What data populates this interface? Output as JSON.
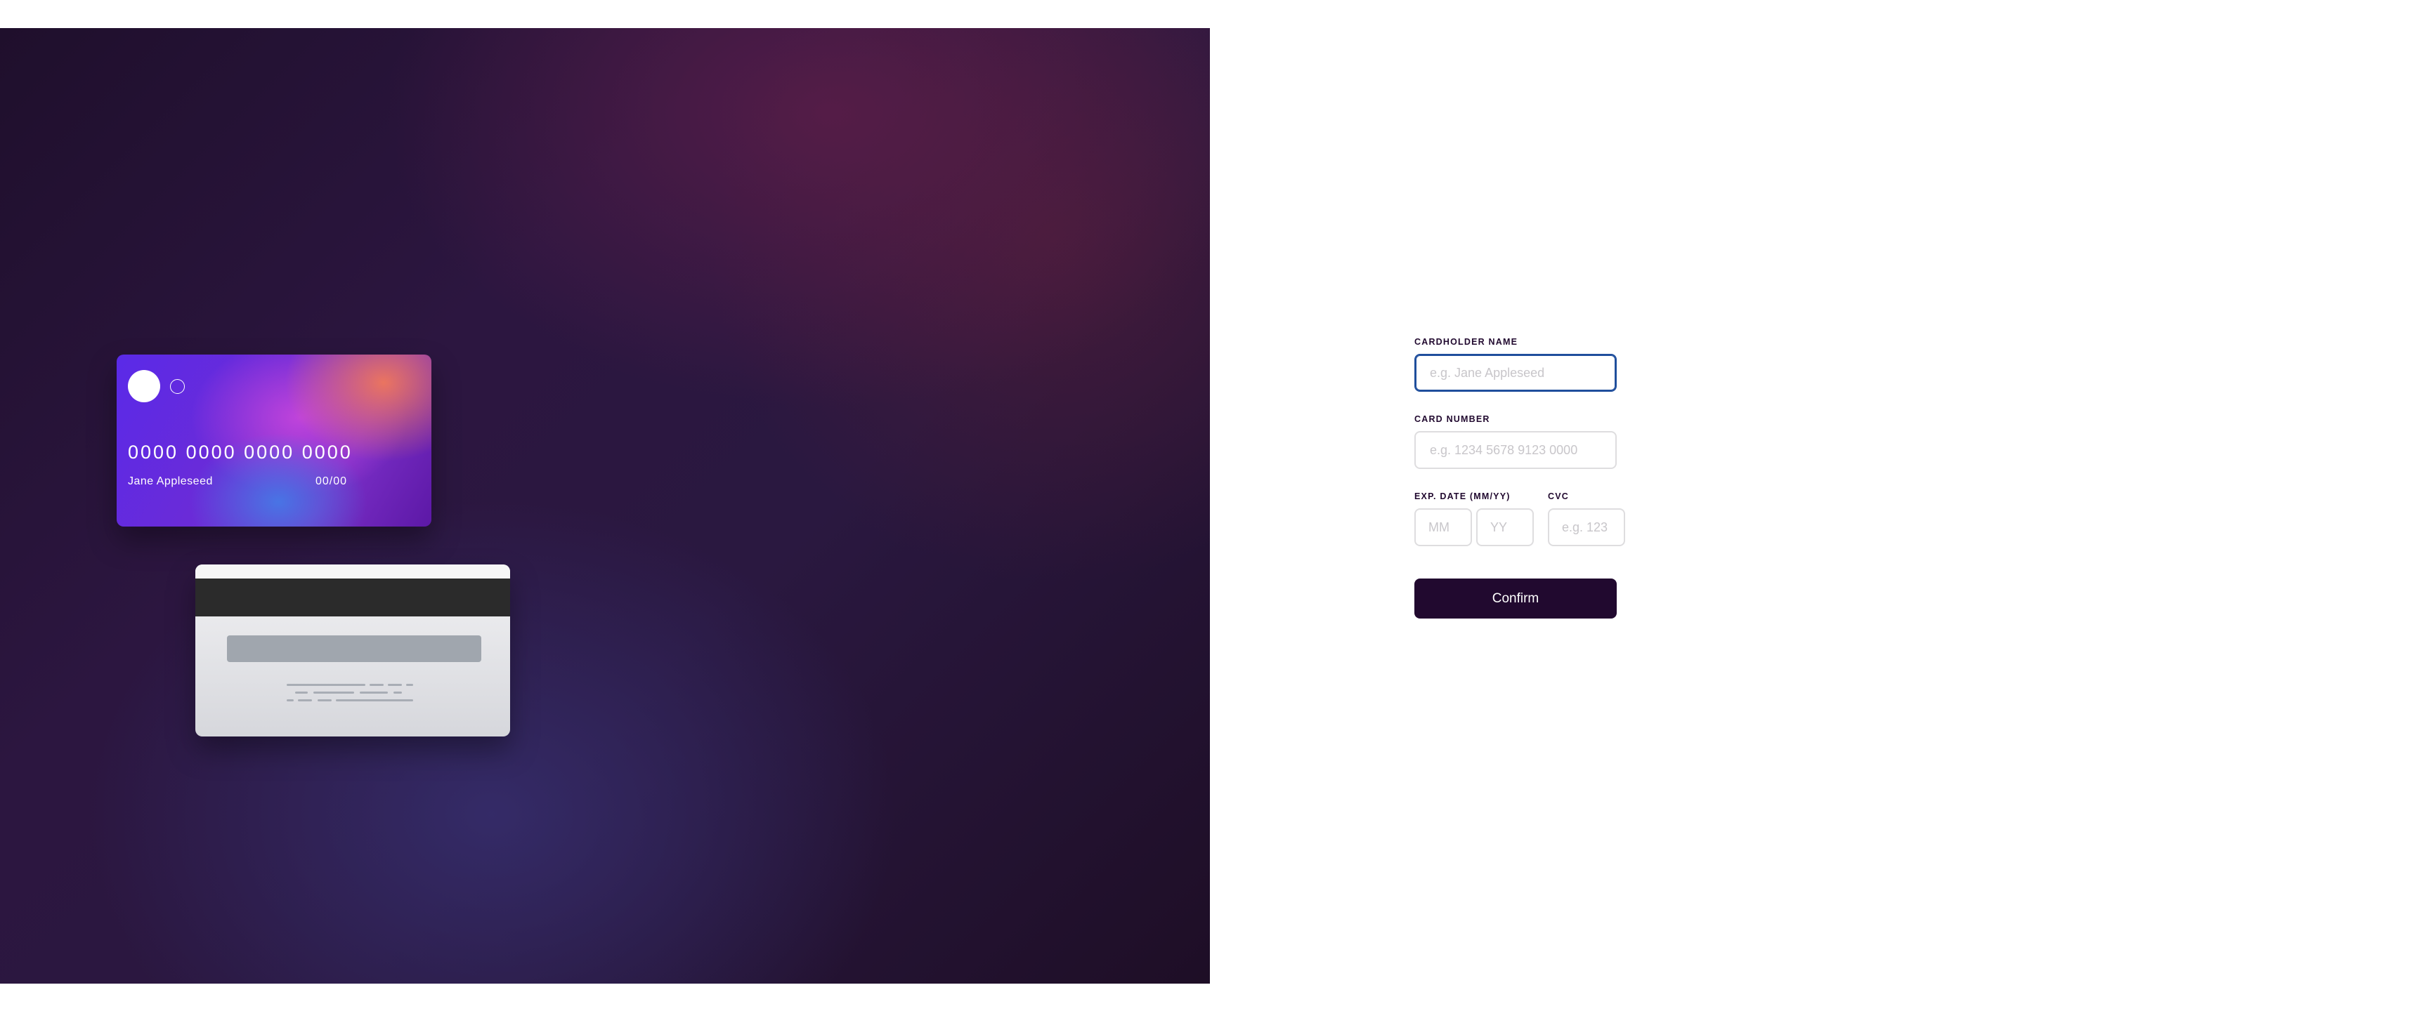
{
  "card_front": {
    "number": "0000 0000 0000 0000",
    "name": "Jane Appleseed",
    "expiry": "00/00"
  },
  "form": {
    "cardholder_label": "Cardholder Name",
    "cardholder_placeholder": "e.g. Jane Appleseed",
    "number_label": "Card Number",
    "number_placeholder": "e.g. 1234 5678 9123 0000",
    "exp_label": "Exp. Date (MM/YY)",
    "month_placeholder": "MM",
    "year_placeholder": "YY",
    "cvc_label": "CVC",
    "cvc_placeholder": "e.g. 123",
    "confirm_label": "Confirm"
  },
  "colors": {
    "accent_dark": "#21092f",
    "focus_border": "#1f4e9c",
    "input_border": "#dedddf"
  },
  "icons": [
    "card-logo-circle-icon",
    "card-logo-ring-icon"
  ]
}
